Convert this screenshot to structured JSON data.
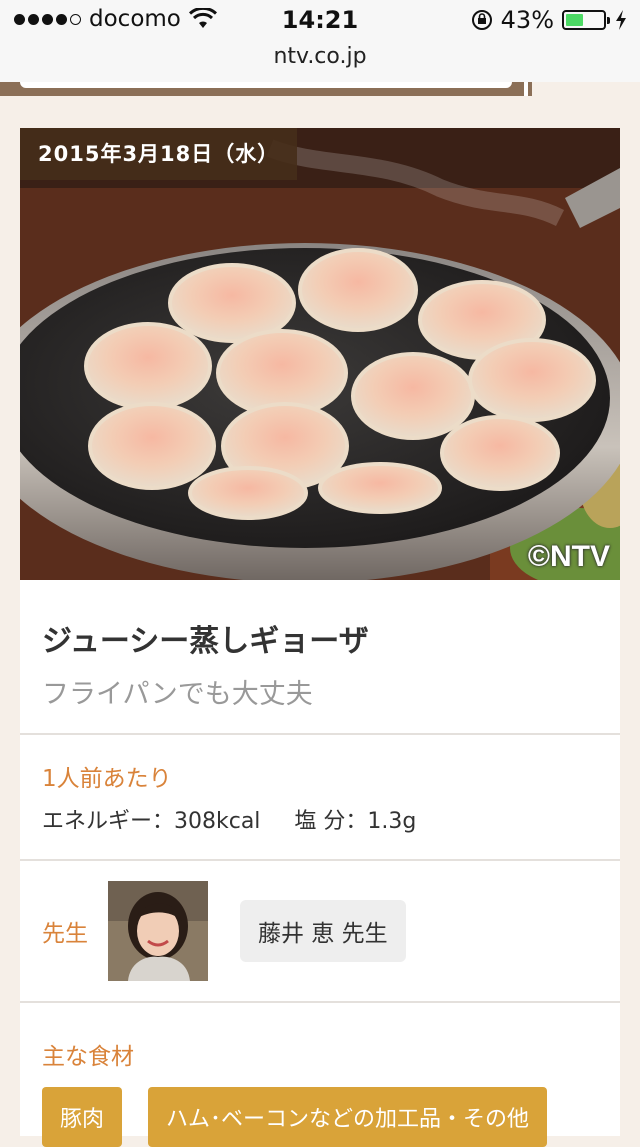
{
  "status_bar": {
    "carrier": "docomo",
    "time": "14:21",
    "battery": "43%",
    "battery_color": "#4cd964"
  },
  "browser": {
    "url": "ntv.co.jp"
  },
  "recipe": {
    "date": "2015年3月18日（水）",
    "image_copyright": "©NTV",
    "title": "ジューシー蒸しギョーザ",
    "subtitle": "フライパンでも大丈夫",
    "per_serving_label": "1人前あたり",
    "energy": "エネルギー：308kcal",
    "salt": "塩 分：1.3g",
    "teacher_label": "先生",
    "teacher_name": "藤井 恵 先生",
    "ingredients_label": "主な食材",
    "ingredient_tags": [
      "豚肉",
      "ハム･ベーコンなどの加工品・その他"
    ]
  },
  "colors": {
    "accent_orange": "#d9833a",
    "tag_gold": "#d9a339",
    "date_badge": "#462d19",
    "page_bg": "#f6efe8"
  },
  "icons": [
    "wifi-icon",
    "rotation-lock-icon",
    "battery-icon",
    "charging-bolt-icon"
  ]
}
